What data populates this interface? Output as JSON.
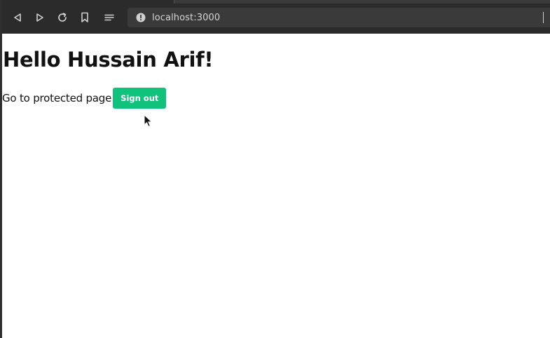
{
  "browser": {
    "url": "localhost:3000",
    "icons": {
      "back": "back-icon",
      "forward": "forward-icon",
      "reload": "reload-icon",
      "bookmark": "bookmark-icon",
      "reader": "reader-mode-icon",
      "site_info": "site-info-icon"
    },
    "colors": {
      "toolbar_bg": "#2b2b2b",
      "urlbar_bg": "#3a3a3a",
      "icon": "#d0d0d0"
    }
  },
  "page": {
    "heading": "Hello Hussain Arif!",
    "protected_link_label": "Go to protected page",
    "signout_label": "Sign out",
    "colors": {
      "signout_bg": "#10c27c",
      "text": "#111111"
    }
  }
}
